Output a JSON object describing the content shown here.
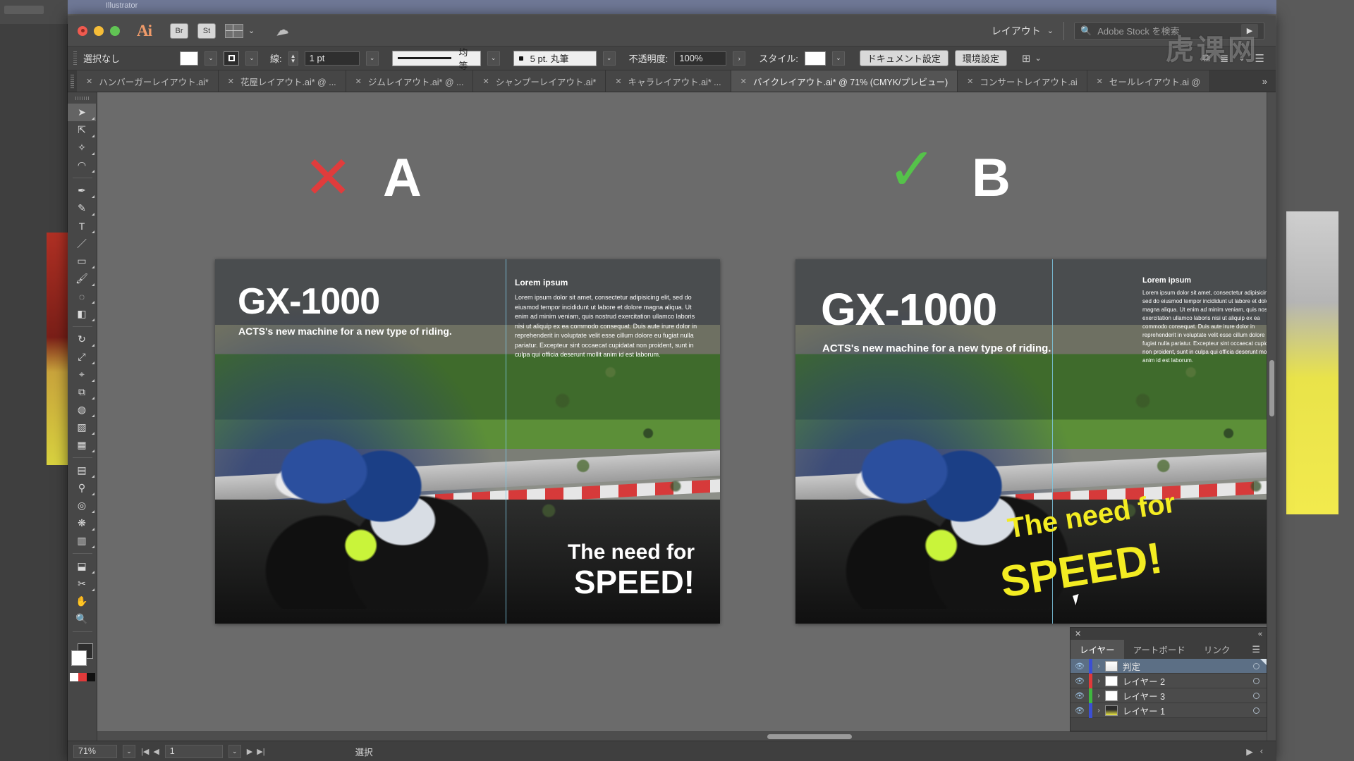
{
  "desktop": {
    "bg_window_title": "Illustrator"
  },
  "titlebar": {
    "app_initials": "Ai",
    "bridge_label": "Br",
    "stock_label": "St",
    "workspace_label": "レイアウト",
    "search_placeholder": "Adobe Stock を検索",
    "watermark": "虎课网"
  },
  "controlbar": {
    "selection_label": "選択なし",
    "stroke_label": "線:",
    "stroke_weight": "1 pt",
    "profile_label": "均等",
    "brush_label": "5 pt. 丸筆",
    "opacity_label": "不透明度:",
    "opacity_value": "100%",
    "style_label": "スタイル:",
    "document_setup": "ドキュメント設定",
    "preferences": "環境設定"
  },
  "tabs": [
    {
      "label": "ハンバーガーレイアウト.ai*",
      "active": false
    },
    {
      "label": "花屋レイアウト.ai* @ ...",
      "active": false
    },
    {
      "label": "ジムレイアウト.ai* @ ...",
      "active": false
    },
    {
      "label": "シャンプーレイアウト.ai*",
      "active": false
    },
    {
      "label": "キャラレイアウト.ai* ...",
      "active": false
    },
    {
      "label": "バイクレイアウト.ai* @ 71% (CMYK/プレビュー)",
      "active": true
    },
    {
      "label": "コンサートレイアウト.ai",
      "active": false
    },
    {
      "label": "セールレイアウト.ai @",
      "active": false
    }
  ],
  "tab_overflow": "»",
  "toolbar": {
    "tools": [
      "selection-tool",
      "direct-selection-tool",
      "magic-wand-tool",
      "lasso-tool",
      "pen-tool",
      "curvature-tool",
      "type-tool",
      "line-tool",
      "rectangle-tool",
      "paintbrush-tool",
      "pencil-tool",
      "eraser-tool",
      "rotate-tool",
      "scale-tool",
      "width-tool",
      "free-transform-tool",
      "shape-builder-tool",
      "perspective-grid-tool",
      "mesh-tool",
      "gradient-tool",
      "eyedropper-tool",
      "blend-tool",
      "symbol-sprayer-tool",
      "column-graph-tool",
      "artboard-tool",
      "slice-tool",
      "hand-tool",
      "zoom-tool"
    ]
  },
  "canvas": {
    "label_a": "A",
    "label_b": "B",
    "mark_bad": "✕",
    "mark_good": "✓",
    "artwork": {
      "headline": "GX-1000",
      "subhead": "ACTS's new machine for a new type of riding.",
      "lorem_heading": "Lorem ipsum",
      "lorem_body": "Lorem ipsum dolor sit amet, consectetur adipisicing elit, sed do eiusmod tempor incididunt ut labore et dolore magna aliqua. Ut enim ad minim veniam, quis nostrud exercitation ullamco laboris nisi ut aliquip ex ea commodo consequat. Duis aute irure dolor in reprehenderit in voluptate velit esse cillum dolore eu fugiat nulla pariatur. Excepteur sint occaecat cupidatat non proident, sunt in culpa qui officia deserunt mollit anim id est laborum.",
      "speed_line1": "The need for",
      "speed_line2": "SPEED!"
    }
  },
  "layers_panel": {
    "close_icon": "✕",
    "collapse_icon": "«",
    "menu_icon": "☰",
    "tabs": [
      {
        "label": "レイヤー",
        "active": true
      },
      {
        "label": "アートボード",
        "active": false
      },
      {
        "label": "リンク",
        "active": false
      }
    ],
    "rows": [
      {
        "name": "判定",
        "color": "#3b4fd4",
        "selected": true,
        "thumb": "mixed"
      },
      {
        "name": "レイヤー 2",
        "color": "#e03a3a",
        "selected": false,
        "thumb": "blank"
      },
      {
        "name": "レイヤー 3",
        "color": "#3fb63f",
        "selected": false,
        "thumb": "blank"
      },
      {
        "name": "レイヤー 1",
        "color": "#3b4fd4",
        "selected": false,
        "thumb": "art"
      }
    ]
  },
  "status": {
    "zoom": "71%",
    "page": "1",
    "mode": "選択",
    "first_icon": "|◀",
    "prev_icon": "◀",
    "next_icon": "▶",
    "last_icon": "▶|"
  }
}
